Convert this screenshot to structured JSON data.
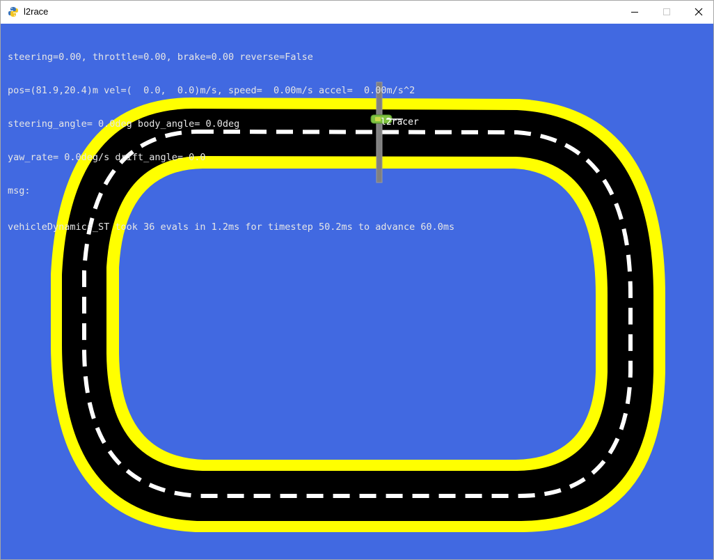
{
  "window": {
    "title": "l2race",
    "icon": "python-snake-icon"
  },
  "title_buttons": {
    "minimize": "minimize-icon",
    "maximize": "maximize-icon",
    "close": "close-icon"
  },
  "hud": {
    "line1": "steering=0.00, throttle=0.00, brake=0.00 reverse=False",
    "line2": "pos=(81.9,20.4)m vel=(  0.0,  0.0)m/s, speed=  0.00m/s accel=  0.00m/s^2",
    "line3": "steering_angle= 0.0deg body_angle= 0.0deg",
    "line4": "yaw_rate= 0.0deg/s drift_angle= 0.0",
    "line5": "msg:",
    "line6": "vehicleDynamics_ST took 36 evals in 1.2ms for timestep 50.2ms to advance 60.0ms"
  },
  "car": {
    "label": "l2racer"
  },
  "colors": {
    "background": "#4169e1",
    "track_border": "#ffff00",
    "track_surface": "#000000",
    "center_dash": "#ffffff",
    "finish_line": "#808080",
    "car_body": "#7fc241",
    "hud_text": "#e6e6e6"
  }
}
